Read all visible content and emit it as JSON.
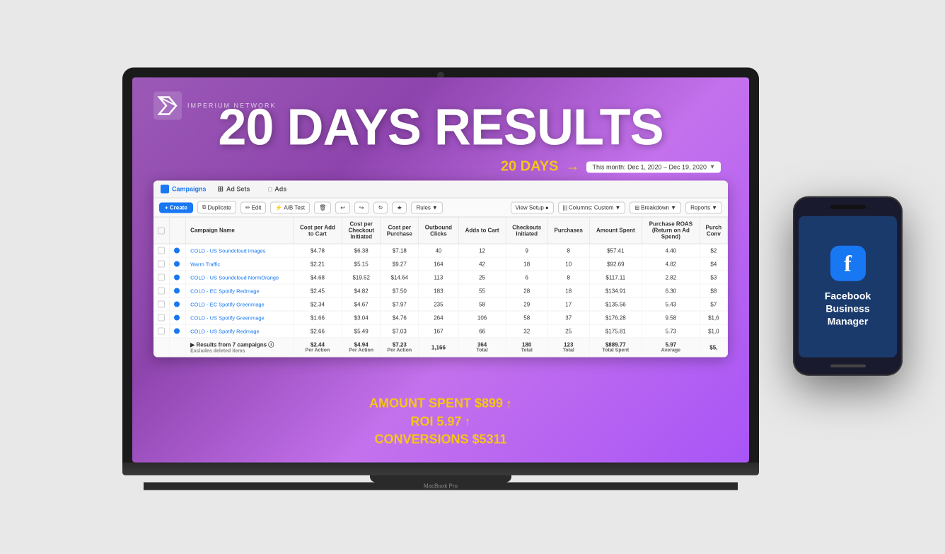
{
  "scene": {
    "bg_color": "#e0e0e0"
  },
  "screen": {
    "title": "20 DAYS RESULTS",
    "days_label": "20 DAYS",
    "arrow": "→",
    "date_range": "This month: Dec 1, 2020 – Dec 19, 2020",
    "logo_text": "IMPERIUM NETWORK"
  },
  "tabs": {
    "campaigns": "Campaigns",
    "ad_sets": "Ad Sets",
    "ads": "Ads"
  },
  "toolbar": {
    "create": "+ Create",
    "duplicate": "Duplicate",
    "edit": "Edit",
    "ab_test": "A/B Test",
    "rules": "Rules",
    "view_setup": "View Setup",
    "columns": "Columns: Custom",
    "breakdown": "Breakdown",
    "reports": "Reports"
  },
  "table": {
    "headers": [
      "",
      "",
      "Campaign Name",
      "Cost per Add to Cart",
      "Cost per Checkout Initiated",
      "Cost per Purchase",
      "Outbound Clicks",
      "Adds to Cart",
      "Checkouts Initiated",
      "Purchases",
      "Amount Spent",
      "Purchase ROAS (Return on Ad Spend)",
      "Purch Conv"
    ],
    "rows": [
      {
        "name": "COLD - US Soundcloud Images",
        "cost_add": "$4.78",
        "cost_checkout": "$6.38",
        "cost_purchase": "$7.18",
        "outbound": "40",
        "adds": "12",
        "checkouts": "9",
        "purchases": "8",
        "spent": "$57.41",
        "roas": "4.40",
        "conv": "$2"
      },
      {
        "name": "Warm Traffic",
        "cost_add": "$2.21",
        "cost_checkout": "$5.15",
        "cost_purchase": "$9.27",
        "outbound": "164",
        "adds": "42",
        "checkouts": "18",
        "purchases": "10",
        "spent": "$92.69",
        "roas": "4.82",
        "conv": "$4"
      },
      {
        "name": "COLD - US Soundcloud NormOrange",
        "cost_add": "$4.68",
        "cost_checkout": "$19.52",
        "cost_purchase": "$14.64",
        "outbound": "113",
        "adds": "25",
        "checkouts": "6",
        "purchases": "8",
        "spent": "$117.11",
        "roas": "2.82",
        "conv": "$3"
      },
      {
        "name": "COLD - EC Spotify Redmage",
        "cost_add": "$2.45",
        "cost_checkout": "$4.82",
        "cost_purchase": "$7.50",
        "outbound": "183",
        "adds": "55",
        "checkouts": "28",
        "purchases": "18",
        "spent": "$134.91",
        "roas": "6.30",
        "conv": "$8"
      },
      {
        "name": "COLD - EC Spotify Greenmage",
        "cost_add": "$2.34",
        "cost_checkout": "$4.67",
        "cost_purchase": "$7.97",
        "outbound": "235",
        "adds": "58",
        "checkouts": "29",
        "purchases": "17",
        "spent": "$135.56",
        "roas": "5.43",
        "conv": "$7"
      },
      {
        "name": "COLD - US Spotify Greenmage",
        "cost_add": "$1.66",
        "cost_checkout": "$3.04",
        "cost_purchase": "$4.76",
        "outbound": "264",
        "adds": "106",
        "checkouts": "58",
        "purchases": "37",
        "spent": "$176.28",
        "roas": "9.58",
        "conv": "$1,6"
      },
      {
        "name": "COLD - US Spotify Redmage",
        "cost_add": "$2.66",
        "cost_checkout": "$5.49",
        "cost_purchase": "$7.03",
        "outbound": "167",
        "adds": "66",
        "checkouts": "32",
        "purchases": "25",
        "spent": "$175.81",
        "roas": "5.73",
        "conv": "$1,0"
      }
    ],
    "totals": {
      "label": "Results from 7 campaigns",
      "sub": "Excludes deleted items",
      "cost_add": "$2.44",
      "cost_add_sub": "Per Action",
      "cost_checkout": "$4.94",
      "cost_checkout_sub": "Per Action",
      "cost_purchase": "$7.23",
      "cost_purchase_sub": "Per Action",
      "outbound": "1,166",
      "adds": "364",
      "adds_sub": "Total",
      "checkouts": "180",
      "checkouts_sub": "Total",
      "purchases": "123",
      "purchases_sub": "Total",
      "spent": "$889.77",
      "spent_sub": "Total Spent",
      "roas": "5.97",
      "roas_sub": "Average",
      "conv": "$5,"
    }
  },
  "stats": {
    "amount_spent": "AMOUNT SPENT $899",
    "roi": "ROI 5.97",
    "conversions": "CONVERSIONS $5311"
  },
  "phone": {
    "app_name": "Facebook Business Manager",
    "fb_letter": "f"
  }
}
